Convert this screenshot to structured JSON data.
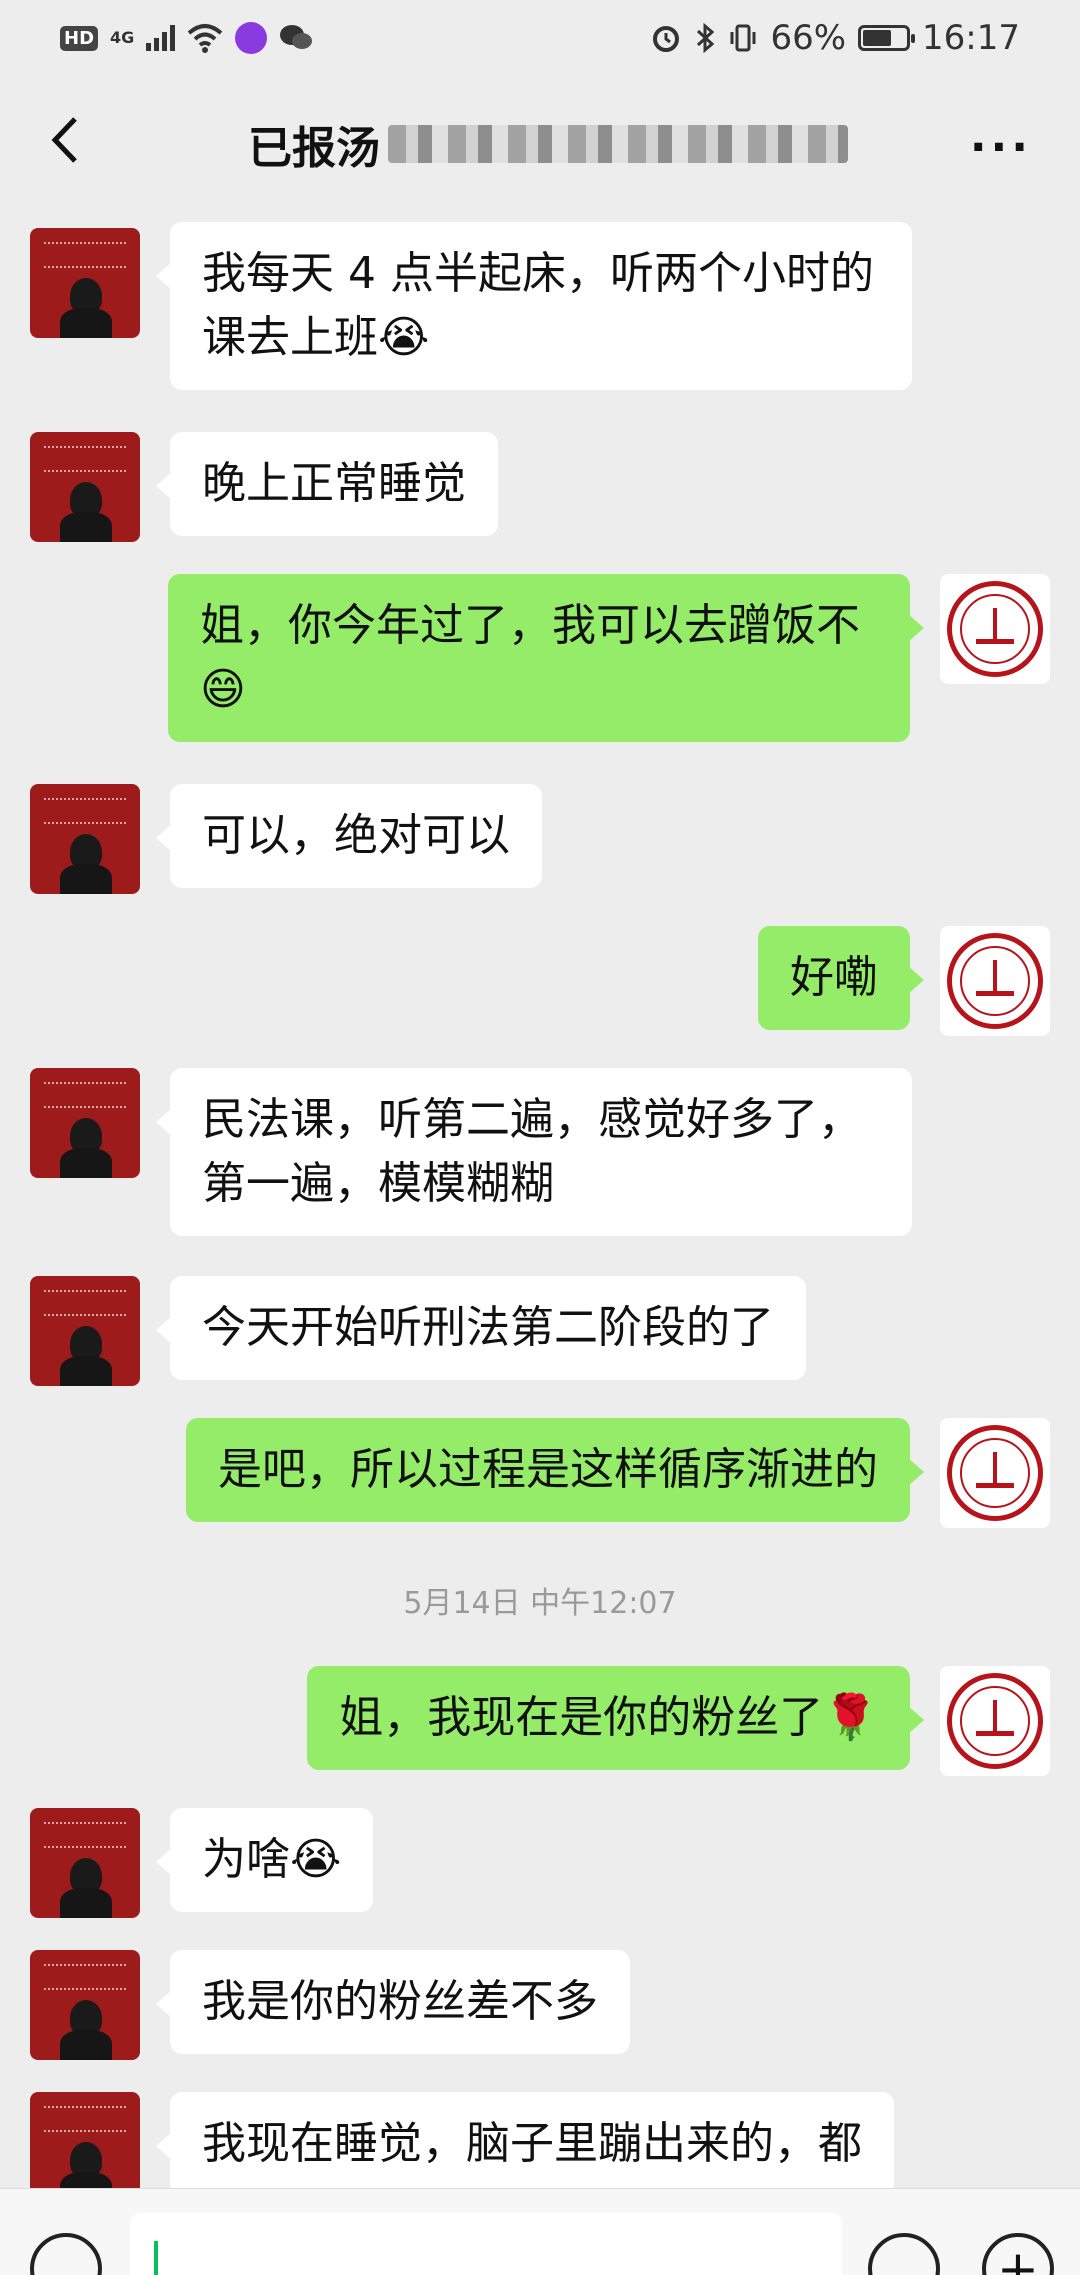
{
  "status_bar": {
    "hd": "HD",
    "network": "4G",
    "battery": "66%",
    "time": "16:17"
  },
  "header": {
    "title": "已报汤"
  },
  "messages": [
    {
      "side": "left",
      "text": "我每天 4 点半起床，听两个小时的课去上班😭"
    },
    {
      "side": "left",
      "text": "晚上正常睡觉"
    },
    {
      "side": "right",
      "text": "姐，你今年过了，我可以去蹭饭不😄"
    },
    {
      "side": "left",
      "text": "可以，绝对可以"
    },
    {
      "side": "right",
      "text": "好嘞"
    },
    {
      "side": "left",
      "text": "民法课，听第二遍，感觉好多了，第一遍，模模糊糊"
    },
    {
      "side": "left",
      "text": "今天开始听刑法第二阶段的了"
    },
    {
      "side": "right",
      "text": "是吧，所以过程是这样循序渐进的"
    },
    {
      "side": "right",
      "text": "姐，我现在是你的粉丝了🌹"
    },
    {
      "side": "left",
      "text": "为啥😭"
    },
    {
      "side": "left",
      "text": "我是你的粉丝差不多"
    },
    {
      "side": "left",
      "text": "我现在睡觉，脑子里蹦出来的，都"
    }
  ],
  "timestamp": "5月14日 中午12:07",
  "icons": {
    "back": "chevron-left-icon",
    "more": "more-icon",
    "voice": "voice-icon",
    "emoji": "emoji-icon",
    "plus": "plus-icon"
  },
  "colors": {
    "background": "#ededed",
    "sent_bubble": "#95ec69",
    "received_bubble": "#ffffff"
  }
}
